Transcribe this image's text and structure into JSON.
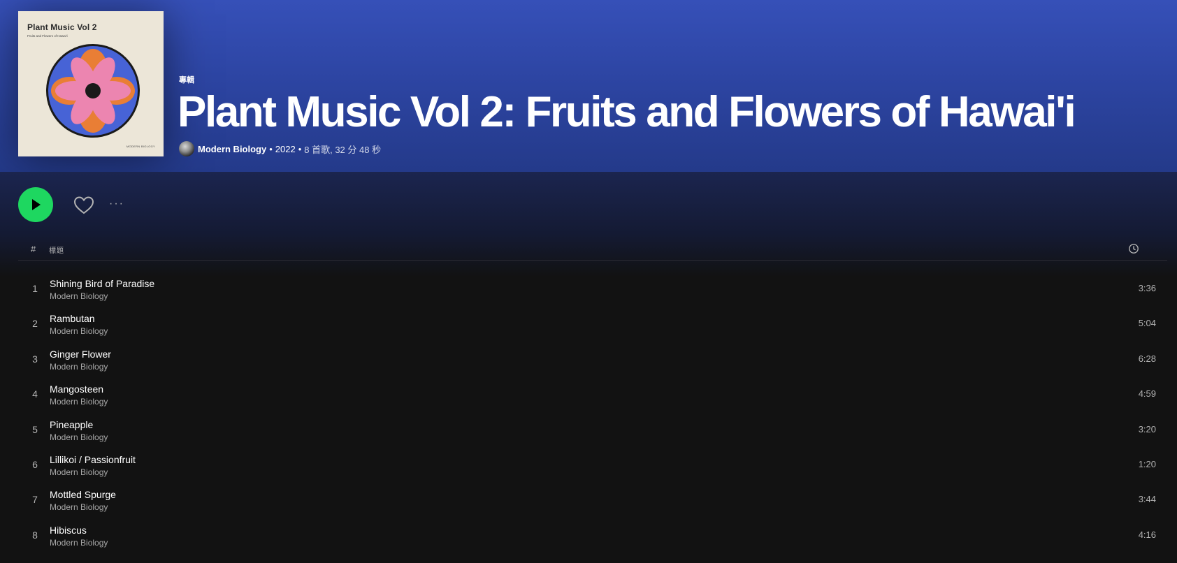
{
  "colors": {
    "accent": "#1ed760",
    "header_top": "#3650b8",
    "background": "#121212",
    "secondary_text": "#b3b3b3"
  },
  "album": {
    "cover": {
      "title": "Plant Music Vol 2",
      "subtitle": "Fruits and Flowers of Hawai'i",
      "brand": "MODERN BIOLOGY"
    },
    "type_label": "專輯",
    "title": "Plant Music Vol 2: Fruits and Flowers of Hawai'i",
    "artist": "Modern Biology",
    "year": "2022",
    "summary": "8 首歌, 32 分 48 秒"
  },
  "meta_separators": [
    "•",
    "•"
  ],
  "actions": {
    "play_icon": "play-icon",
    "like_icon": "heart-icon",
    "more_label": "···"
  },
  "table": {
    "col_number": "#",
    "col_title": "標題",
    "col_duration_icon": "clock-icon"
  },
  "tracks": [
    {
      "number": "1",
      "title": "Shining Bird of Paradise",
      "artist": "Modern Biology",
      "duration": "3:36"
    },
    {
      "number": "2",
      "title": "Rambutan",
      "artist": "Modern Biology",
      "duration": "5:04"
    },
    {
      "number": "3",
      "title": "Ginger Flower",
      "artist": "Modern Biology",
      "duration": "6:28"
    },
    {
      "number": "4",
      "title": "Mangosteen",
      "artist": "Modern Biology",
      "duration": "4:59"
    },
    {
      "number": "5",
      "title": "Pineapple",
      "artist": "Modern Biology",
      "duration": "3:20"
    },
    {
      "number": "6",
      "title": "Lillikoi / Passionfruit",
      "artist": "Modern Biology",
      "duration": "1:20"
    },
    {
      "number": "7",
      "title": "Mottled Spurge",
      "artist": "Modern Biology",
      "duration": "3:44"
    },
    {
      "number": "8",
      "title": "Hibiscus",
      "artist": "Modern Biology",
      "duration": "4:16"
    }
  ]
}
